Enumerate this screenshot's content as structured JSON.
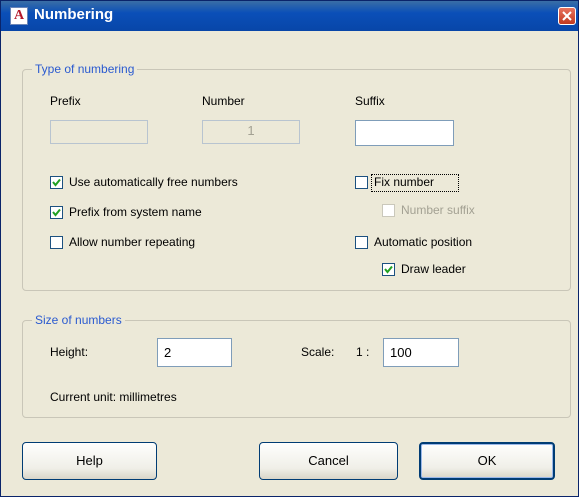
{
  "window": {
    "title": "Numbering",
    "icon": "autocad-a-icon",
    "icon_glyph": "A"
  },
  "type_group": {
    "label": "Type of numbering",
    "prefix_label": "Prefix",
    "number_label": "Number",
    "suffix_label": "Suffix",
    "prefix_value": "",
    "number_value": "1",
    "suffix_value": "",
    "checkboxes": {
      "use_free_numbers": {
        "label": "Use automatically free numbers",
        "checked": true
      },
      "prefix_system": {
        "label": "Prefix from system name",
        "checked": true
      },
      "allow_repeat": {
        "label": "Allow number repeating",
        "checked": false
      },
      "fix_number": {
        "label": "Fix number",
        "checked": false
      },
      "number_suffix": {
        "label": "Number suffix",
        "checked": false,
        "disabled": true
      },
      "auto_position": {
        "label": "Automatic position",
        "checked": false
      },
      "draw_leader": {
        "label": "Draw leader",
        "checked": true
      }
    }
  },
  "size_group": {
    "label": "Size of numbers",
    "height_label": "Height:",
    "height_value": "2",
    "scale_label": "Scale:",
    "scale_prefix": "1 :",
    "scale_value": "100",
    "current_unit": "Current unit: millimetres"
  },
  "buttons": {
    "help": "Help",
    "cancel": "Cancel",
    "ok": "OK"
  },
  "colors": {
    "title_bar": "#0a4fb8",
    "group_label": "#2a5ad0",
    "check_mark": "#21a121"
  }
}
